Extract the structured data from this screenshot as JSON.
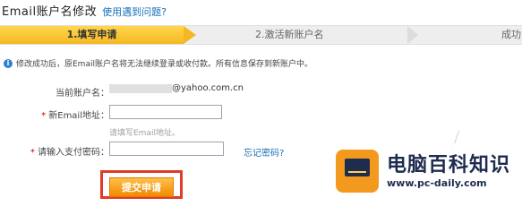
{
  "header": {
    "title": "Email账户名修改",
    "help_link": "使用遇到问题?"
  },
  "steps": {
    "step1": "1.填写申请",
    "step2": "2.激活新账户名",
    "step3": "成功"
  },
  "notice": {
    "icon": "info-icon",
    "text": "修改成功后，原Email账户名将无法继续登录或收付款。所有信息保存到新账户中。"
  },
  "form": {
    "current_account_label": "当前账户名：",
    "current_account_value": "@yahoo.com.cn",
    "new_email_label": "新Email地址：",
    "new_email_value": "",
    "new_email_hint": "请填写Email地址。",
    "password_label": "请输入支付密码：",
    "password_value": "",
    "forgot_link": "忘记密码?",
    "submit_label": "提交申请"
  },
  "watermark": {
    "title": "电脑百科知识",
    "url": "www.pc-daily.com",
    "colors": {
      "brand": "#1d2c4f",
      "accent": "#f39a1e"
    }
  }
}
